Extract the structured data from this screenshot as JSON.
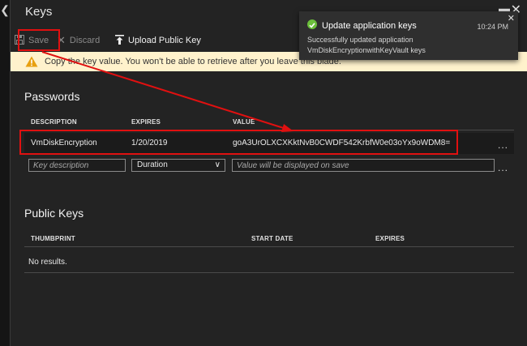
{
  "blade": {
    "title": "Keys",
    "collapse_icon": "chevron-left-icon",
    "maximize_icon": "maximize-icon",
    "close_icon": "close-icon"
  },
  "toolbar": {
    "save_label": "Save",
    "discard_label": "Discard",
    "upload_label": "Upload Public Key"
  },
  "warning": {
    "text": "Copy the key value. You won't be able to retrieve after you leave this blade.",
    "icon": "warning-icon",
    "background": "#fff2cc"
  },
  "passwords": {
    "title": "Passwords",
    "columns": [
      "DESCRIPTION",
      "EXPIRES",
      "VALUE"
    ],
    "rows": [
      {
        "description": "VmDiskEncryption",
        "expires": "1/20/2019",
        "value": "goA3UrOLXCXKktNvB0CWDF542KrbfW0e03oYx9oWDM8="
      }
    ],
    "new_row": {
      "description_placeholder": "Key description",
      "duration_selected": "Duration",
      "value_placeholder": "Value will be displayed on save"
    },
    "more_label": "..."
  },
  "public_keys": {
    "title": "Public Keys",
    "columns": [
      "THUMBPRINT",
      "START DATE",
      "EXPIRES"
    ],
    "empty_text": "No results."
  },
  "toast": {
    "title": "Update application keys",
    "time": "10:24 PM",
    "message": "Successfully updated application VmDiskEncryptionwithKeyVault keys",
    "icon": "success-check-icon",
    "status_color": "#6bbf3b"
  },
  "annotation_color": "#e01010"
}
